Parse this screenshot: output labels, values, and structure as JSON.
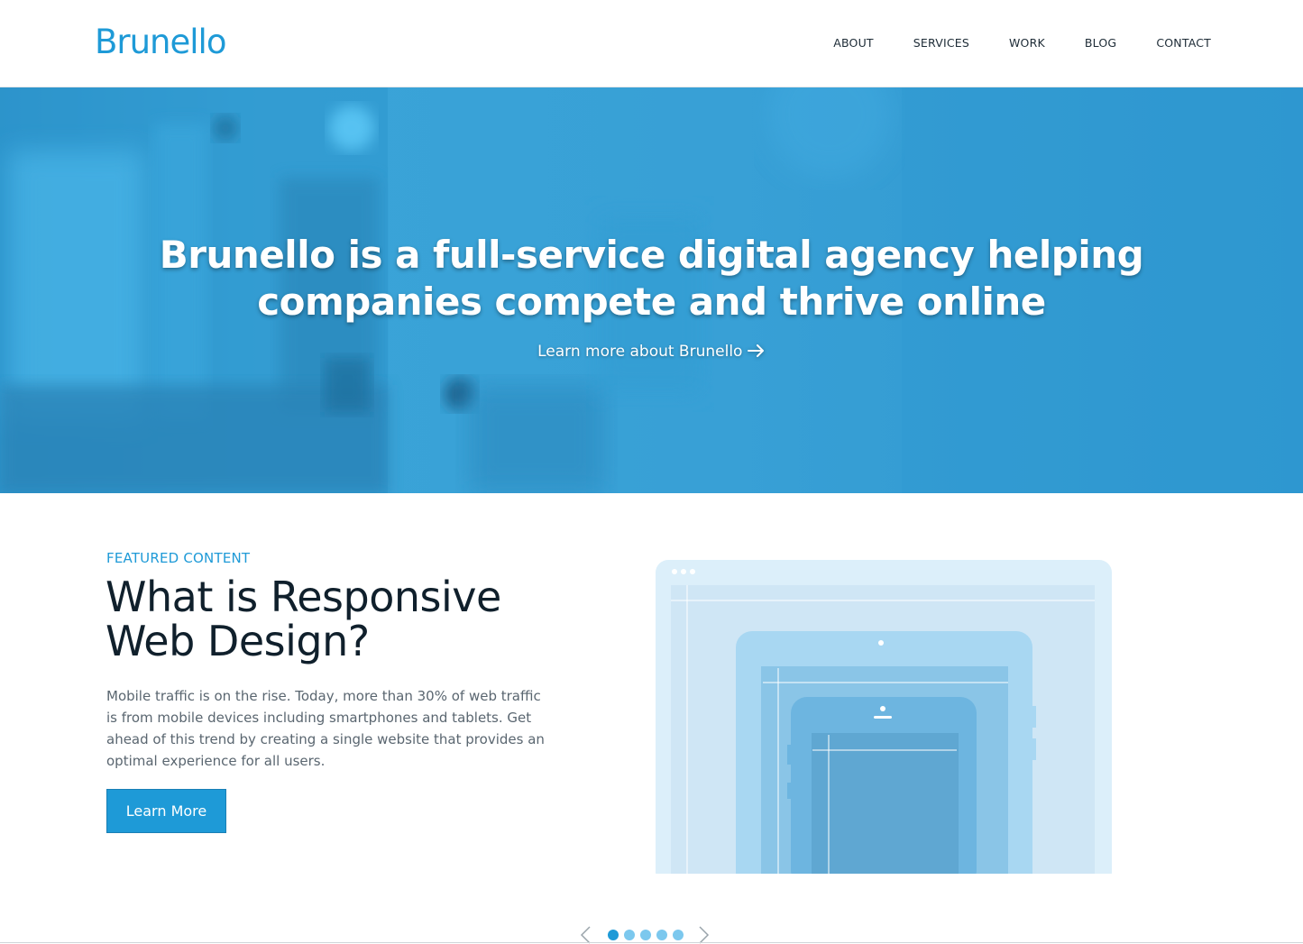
{
  "brand": {
    "logo_text": "Brunello",
    "accent": "#1e9ad7"
  },
  "nav": {
    "items": [
      {
        "label": "ABOUT"
      },
      {
        "label": "SERVICES"
      },
      {
        "label": "WORK"
      },
      {
        "label": "BLOG"
      },
      {
        "label": "CONTACT"
      }
    ]
  },
  "hero": {
    "title_line1": "Brunello is a full-service digital agency helping",
    "title_line2": "companies compete and thrive online",
    "link_label": "Learn more about Brunello",
    "link_icon": "arrow-right-icon"
  },
  "featured": {
    "label": "FEATURED CONTENT",
    "title_line1": "What is Responsive",
    "title_line2": "Web Design?",
    "body": "Mobile traffic is on the rise. Today, more than 30% of web traffic is from mobile devices including smartphones and tablets. Get ahead of this trend by creating a single website that provides an optimal experience for all users.",
    "button_label": "Learn More"
  },
  "carousel": {
    "prev_icon": "chevron-left-icon",
    "next_icon": "chevron-right-icon",
    "slide_count": 5,
    "active_index": 0
  }
}
